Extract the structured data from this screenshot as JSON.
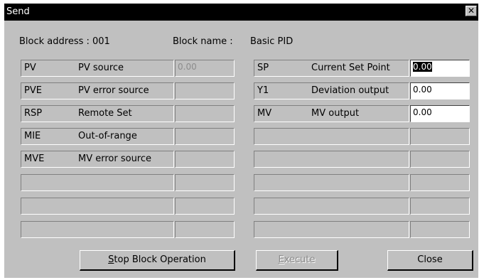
{
  "window": {
    "title": "Send",
    "close_glyph": "✕"
  },
  "header": {
    "block_address_label": "Block address : 001",
    "block_name_label": "Block name :",
    "block_name_value": "Basic PID"
  },
  "left_rows": [
    {
      "code": "PV",
      "desc": "PV source",
      "value": "0.00"
    },
    {
      "code": "PVE",
      "desc": "PV error source",
      "value": ""
    },
    {
      "code": "RSP",
      "desc": "Remote Set",
      "value": ""
    },
    {
      "code": "MIE",
      "desc": "Out-of-range",
      "value": ""
    },
    {
      "code": "MVE",
      "desc": "MV error source",
      "value": ""
    },
    {
      "code": "",
      "desc": "",
      "value": ""
    },
    {
      "code": "",
      "desc": "",
      "value": ""
    },
    {
      "code": "",
      "desc": "",
      "value": ""
    }
  ],
  "right_rows": [
    {
      "code": "SP",
      "desc": "Current Set Point",
      "value": "0.00"
    },
    {
      "code": "Y1",
      "desc": "Deviation output",
      "value": "0.00"
    },
    {
      "code": "MV",
      "desc": "MV output",
      "value": "0.00"
    },
    {
      "code": "",
      "desc": "",
      "value": ""
    },
    {
      "code": "",
      "desc": "",
      "value": ""
    },
    {
      "code": "",
      "desc": "",
      "value": ""
    },
    {
      "code": "",
      "desc": "",
      "value": ""
    },
    {
      "code": "",
      "desc": "",
      "value": ""
    }
  ],
  "buttons": {
    "stop_mnemonic": "S",
    "stop_rest": "top Block Operation",
    "execute_mnemonic": "E",
    "execute_rest": "xecute",
    "close": "Close"
  }
}
